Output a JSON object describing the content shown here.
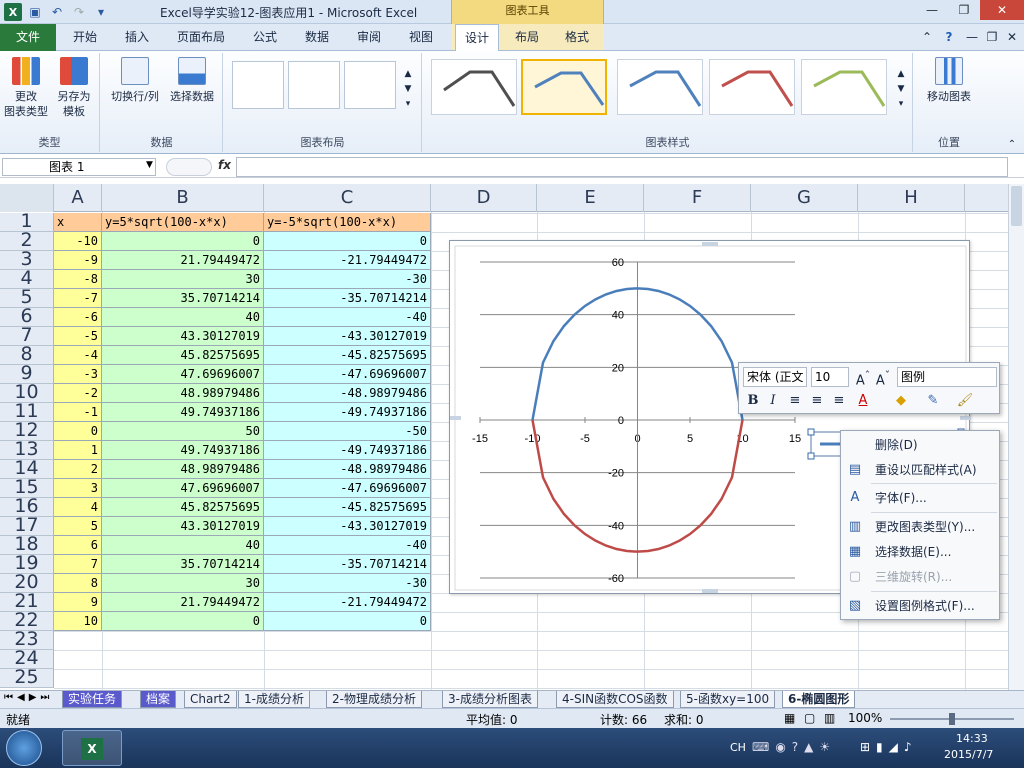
{
  "window": {
    "title": "Excel导学实验12-图表应用1  -  Microsoft Excel",
    "context_title": "图表工具"
  },
  "tabs": [
    "文件",
    "开始",
    "插入",
    "页面布局",
    "公式",
    "数据",
    "审阅",
    "视图",
    "设计",
    "布局",
    "格式"
  ],
  "ribbon": {
    "groups": {
      "type": {
        "label": "类型",
        "change_type": "更改\n图表类型",
        "save_template": "另存为\n模板"
      },
      "data": {
        "label": "数据",
        "switch_rowcol": "切换行/列",
        "select_data": "选择数据"
      },
      "layout": {
        "label": "图表布局"
      },
      "styles": {
        "label": "图表样式"
      },
      "location": {
        "label": "位置",
        "move_chart": "移动图表"
      }
    },
    "style_colors": [
      "#4f4f4f",
      "#4f81bd",
      "#4f81bd",
      "#c0504d",
      "#9bbb59"
    ]
  },
  "formula_bar": {
    "name_box": "图表 1",
    "fx": "fx",
    "formula": ""
  },
  "columns": [
    "A",
    "B",
    "C",
    "D",
    "E",
    "F",
    "G",
    "H"
  ],
  "rows": [
    "1",
    "2",
    "3",
    "4",
    "5",
    "6",
    "7",
    "8",
    "9",
    "10",
    "11",
    "12",
    "13",
    "14",
    "15",
    "16",
    "17",
    "18",
    "19",
    "20",
    "21",
    "22",
    "23",
    "24",
    "25"
  ],
  "sheet": {
    "headers": [
      "x",
      "y=5*sqrt(100-x*x)",
      "y=-5*sqrt(100-x*x)"
    ],
    "data": [
      [
        "-10",
        "0",
        "0"
      ],
      [
        "-9",
        "21.79449472",
        "-21.79449472"
      ],
      [
        "-8",
        "30",
        "-30"
      ],
      [
        "-7",
        "35.70714214",
        "-35.70714214"
      ],
      [
        "-6",
        "40",
        "-40"
      ],
      [
        "-5",
        "43.30127019",
        "-43.30127019"
      ],
      [
        "-4",
        "45.82575695",
        "-45.82575695"
      ],
      [
        "-3",
        "47.69696007",
        "-47.69696007"
      ],
      [
        "-2",
        "48.98979486",
        "-48.98979486"
      ],
      [
        "-1",
        "49.74937186",
        "-49.74937186"
      ],
      [
        "0",
        "50",
        "-50"
      ],
      [
        "1",
        "49.74937186",
        "-49.74937186"
      ],
      [
        "2",
        "48.98979486",
        "-48.98979486"
      ],
      [
        "3",
        "47.69696007",
        "-47.69696007"
      ],
      [
        "4",
        "45.82575695",
        "-45.82575695"
      ],
      [
        "5",
        "43.30127019",
        "-43.30127019"
      ],
      [
        "6",
        "40",
        "-40"
      ],
      [
        "7",
        "35.70714214",
        "-35.70714214"
      ],
      [
        "8",
        "30",
        "-30"
      ],
      [
        "9",
        "21.79449472",
        "-21.79449472"
      ],
      [
        "10",
        "0",
        "0"
      ]
    ]
  },
  "chart_data": {
    "type": "line",
    "x": [
      -10,
      -9,
      -8,
      -7,
      -6,
      -5,
      -4,
      -3,
      -2,
      -1,
      0,
      1,
      2,
      3,
      4,
      5,
      6,
      7,
      8,
      9,
      10
    ],
    "series": [
      {
        "name": "y=5*sqrt(100-x*x)",
        "color": "#4a7ebb",
        "values": [
          0,
          21.79449472,
          30,
          35.70714214,
          40,
          43.30127019,
          45.82575695,
          47.69696007,
          48.98979486,
          49.74937186,
          50,
          49.74937186,
          48.98979486,
          47.69696007,
          45.82575695,
          43.30127019,
          40,
          35.70714214,
          30,
          21.79449472,
          0
        ]
      },
      {
        "name": "y=-5*sqrt(100-x*x)",
        "color": "#be4b48",
        "values": [
          0,
          -21.79449472,
          -30,
          -35.70714214,
          -40,
          -43.30127019,
          -45.82575695,
          -47.69696007,
          -48.98979486,
          -49.74937186,
          -50,
          -49.74937186,
          -48.98979486,
          -47.69696007,
          -45.82575695,
          -43.30127019,
          -40,
          -35.70714214,
          -30,
          -21.79449472,
          0
        ]
      }
    ],
    "xlim": [
      -15,
      15
    ],
    "ylim": [
      -60,
      60
    ],
    "xticks": [
      -15,
      -10,
      -5,
      0,
      5,
      10,
      15
    ],
    "yticks": [
      -60,
      -40,
      -20,
      0,
      20,
      40,
      60
    ],
    "legend_text": "y=5*sqrt(100-x*x)",
    "grid": true,
    "legend": "right"
  },
  "mini_toolbar": {
    "font": "宋体 (正文",
    "size": "10",
    "element": "图例",
    "bold": "B",
    "italic": "I"
  },
  "context_menu": [
    {
      "label": "删除(D)",
      "icon": "",
      "disabled": false
    },
    {
      "label": "重设以匹配样式(A)",
      "icon": "reset-style-icon",
      "disabled": false
    },
    {
      "label": "字体(F)...",
      "icon": "font-icon",
      "disabled": false
    },
    {
      "label": "更改图表类型(Y)...",
      "icon": "chart-type-icon",
      "disabled": false
    },
    {
      "label": "选择数据(E)...",
      "icon": "select-data-icon",
      "disabled": false
    },
    {
      "label": "三维旋转(R)...",
      "icon": "rotate-3d-icon",
      "disabled": true
    },
    {
      "label": "设置图例格式(F)...",
      "icon": "format-legend-icon",
      "disabled": false
    }
  ],
  "sheet_tabs": [
    "实验任务",
    "档案",
    "Chart2",
    "1-成绩分析",
    "2-物理成绩分析",
    "3-成绩分析图表",
    "4-SIN函数COS函数",
    "5-函数xy=100",
    "6-椭圆图形"
  ],
  "status": {
    "ready": "就绪",
    "average": "平均值: 0",
    "count": "计数: 66",
    "sum": "求和: 0",
    "zoom": "100%"
  },
  "taskbar": {
    "lang": "CH",
    "time": "14:33",
    "date": "2015/7/7"
  }
}
